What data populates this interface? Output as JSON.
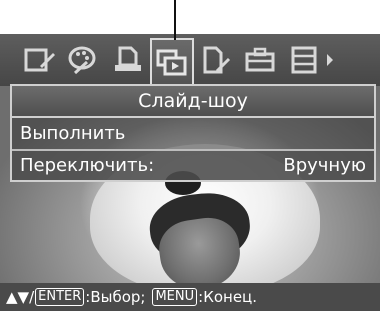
{
  "menu": {
    "title": "Слайд-шоу",
    "items": [
      {
        "label": "Выполнить",
        "value": ""
      },
      {
        "label": "Переключить:",
        "value": "Вручную"
      }
    ]
  },
  "helpbar": {
    "arrows": "▲▼/",
    "enter_key": "ENTER",
    "enter_action": ":Выбор;",
    "menu_key": "MENU",
    "menu_action": ":Конец."
  },
  "tabs": [
    {
      "icon": "edit-icon"
    },
    {
      "icon": "palette-icon"
    },
    {
      "icon": "print-icon"
    },
    {
      "icon": "slideshow-icon",
      "selected": true
    },
    {
      "icon": "file-settings-icon"
    },
    {
      "icon": "toolbox-icon"
    },
    {
      "icon": "list-icon"
    }
  ],
  "colors": {
    "tabbar": "#555555",
    "panel_border": "#cfcfcf",
    "text": "#ffffff"
  }
}
